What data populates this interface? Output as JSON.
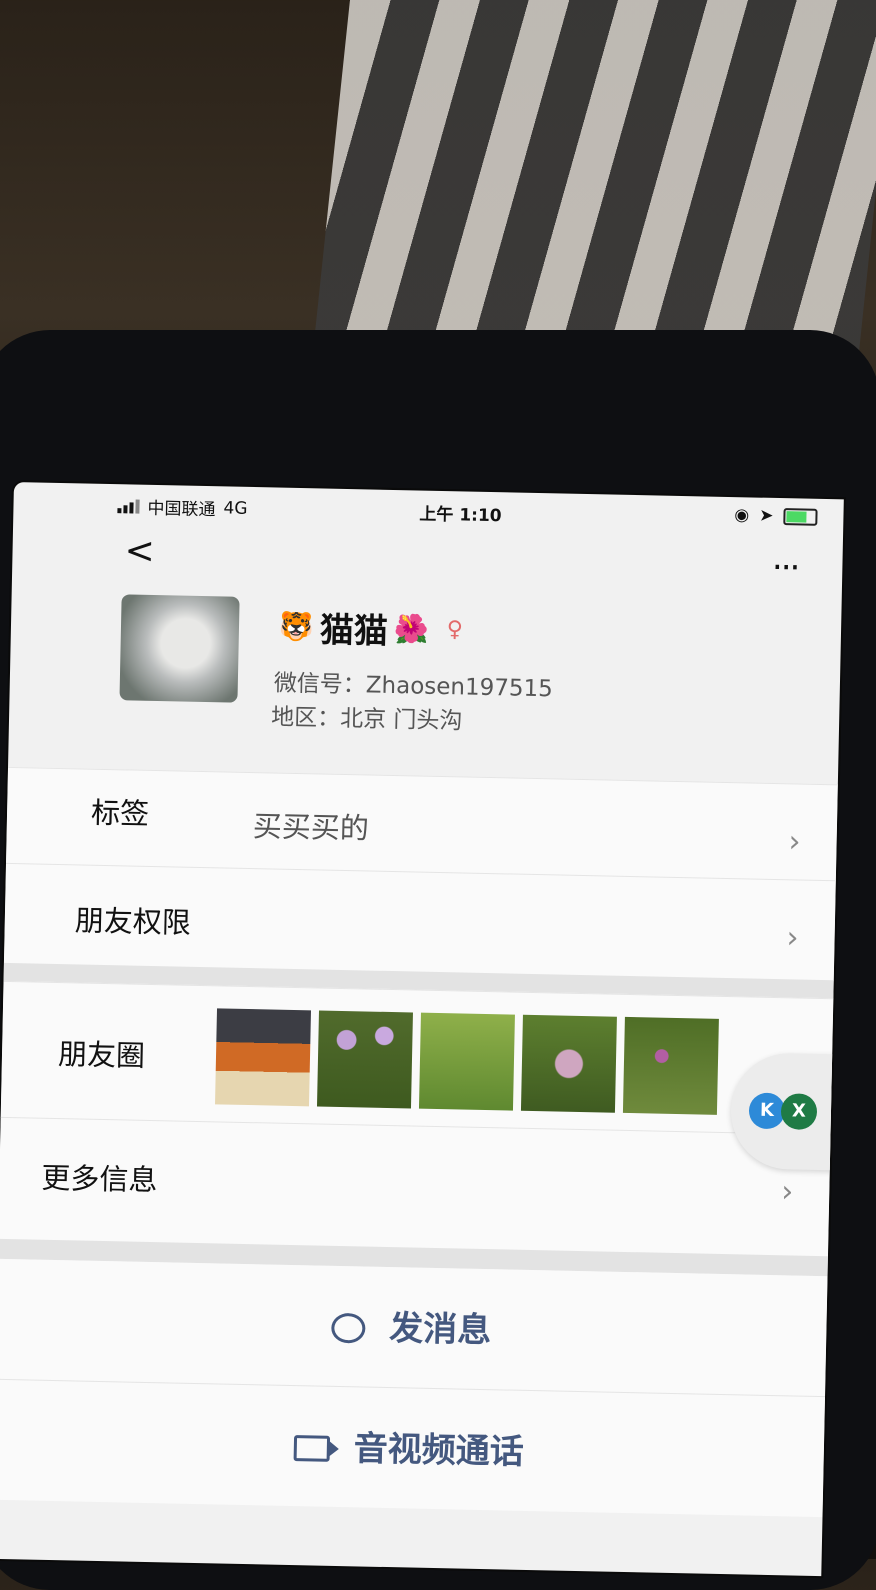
{
  "status": {
    "carrier": "中国联通",
    "network": "4G",
    "time": "上午 1:10"
  },
  "nav": {
    "back": "<",
    "more": "..."
  },
  "profile": {
    "name": "猫猫",
    "emoji_left": "🐯",
    "emoji_right": "🌺",
    "gender_icon": "person-icon",
    "wxid": "微信号：Zhaosen197515",
    "region": "地区：北京 门头沟"
  },
  "rows": {
    "tags_label": "标签",
    "tags_value": "买买买的",
    "permission_label": "朋友权限",
    "moments_label": "朋友圈",
    "more_info_label": "更多信息"
  },
  "actions": {
    "message": "发消息",
    "call": "音视频通话"
  },
  "floating": {
    "left": "K",
    "right": "X"
  },
  "colors": {
    "accent": "#44587f",
    "background": "#f1f1f1"
  }
}
